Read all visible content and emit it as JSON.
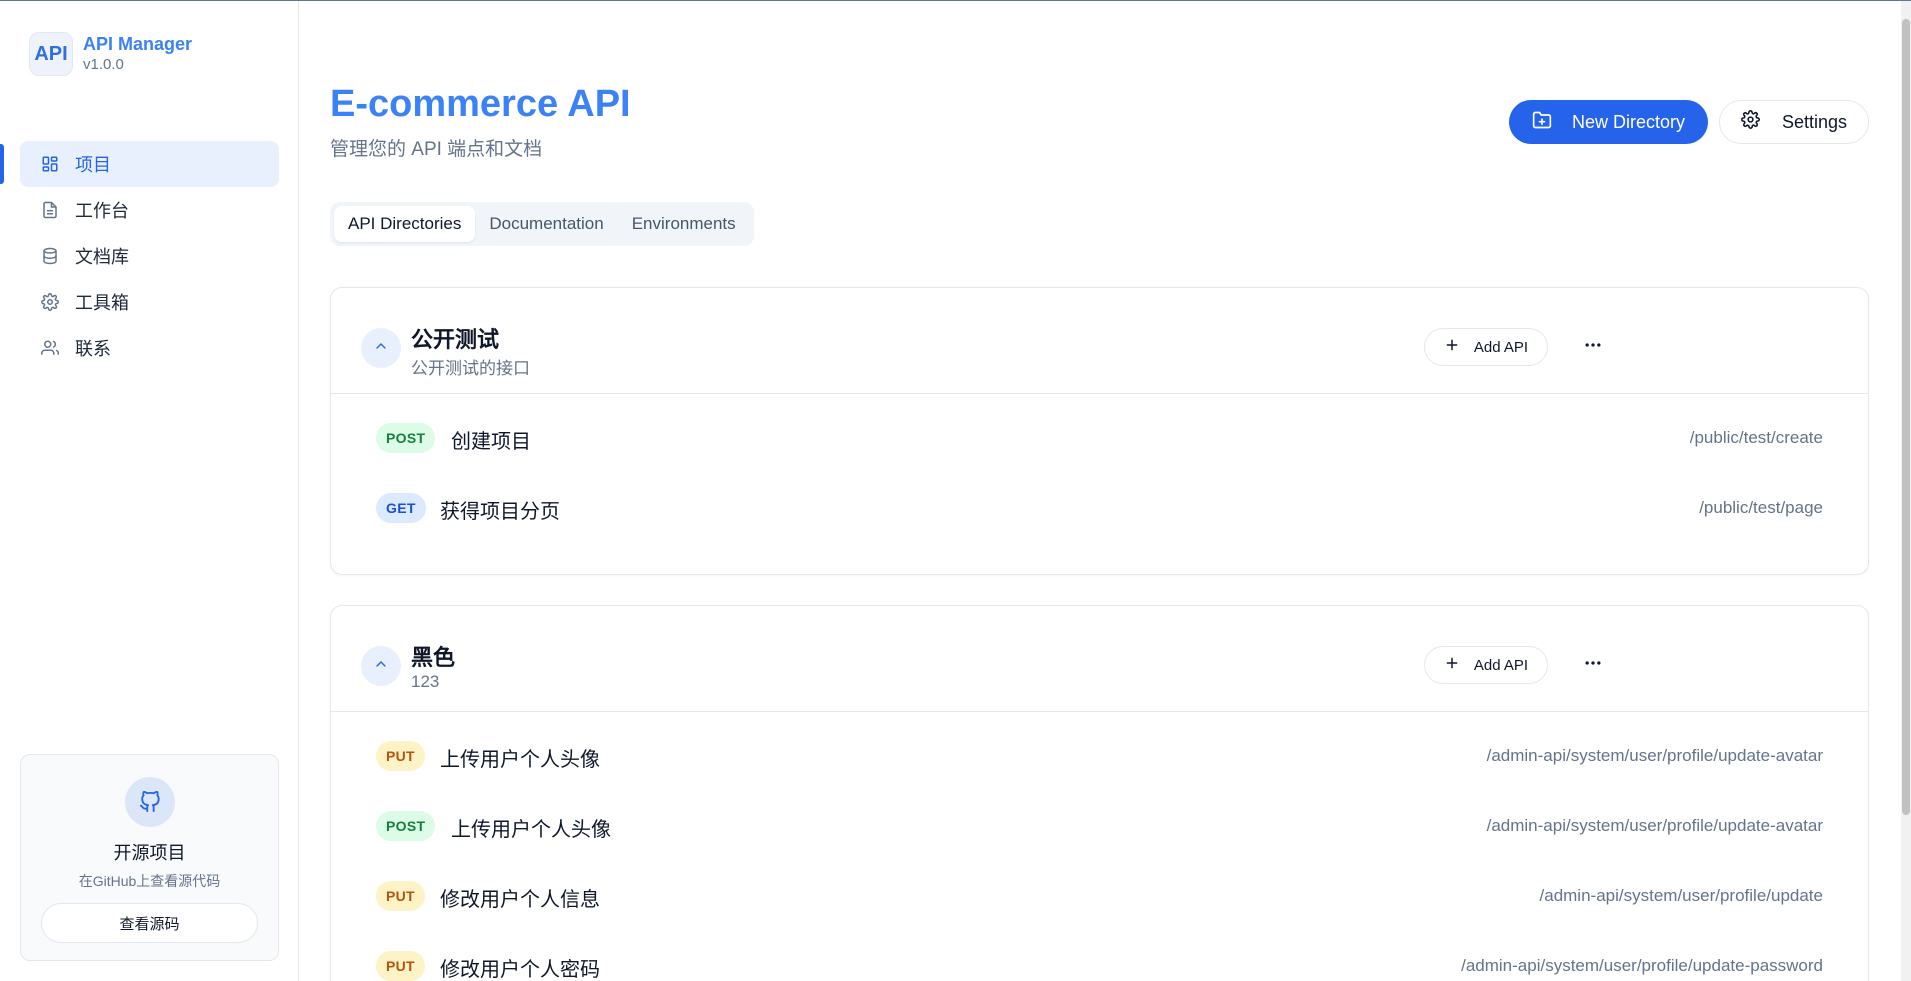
{
  "brand": {
    "logo": "API",
    "name": "API Manager",
    "version": "v1.0.0"
  },
  "sidebar": {
    "items": [
      {
        "label": "项目",
        "icon": "grid-icon",
        "active": true
      },
      {
        "label": "工作台",
        "icon": "file-icon",
        "active": false
      },
      {
        "label": "文档库",
        "icon": "database-icon",
        "active": false
      },
      {
        "label": "工具箱",
        "icon": "gear-icon",
        "active": false
      },
      {
        "label": "联系",
        "icon": "users-icon",
        "active": false
      }
    ],
    "oss": {
      "title": "开源项目",
      "subtitle": "在GitHub上查看源代码",
      "button": "查看源码",
      "icon": "github-icon"
    }
  },
  "header": {
    "title": "E-commerce API",
    "subtitle": "管理您的 API 端点和文档",
    "new_directory": "New Directory",
    "settings": "Settings"
  },
  "tabs": [
    {
      "label": "API Directories",
      "active": true
    },
    {
      "label": "Documentation",
      "active": false
    },
    {
      "label": "Environments",
      "active": false
    }
  ],
  "groups": [
    {
      "name": "公开测试",
      "description": "公开测试的接口",
      "add_label": "Add API",
      "endpoints": [
        {
          "method": "POST",
          "name": "创建项目",
          "path": "/public/test/create"
        },
        {
          "method": "GET",
          "name": "获得项目分页",
          "path": "/public/test/page"
        }
      ]
    },
    {
      "name": "黑色",
      "description": "123",
      "add_label": "Add API",
      "endpoints": [
        {
          "method": "PUT",
          "name": "上传用户个人头像",
          "path": "/admin-api/system/user/profile/update-avatar"
        },
        {
          "method": "POST",
          "name": "上传用户个人头像",
          "path": "/admin-api/system/user/profile/update-avatar"
        },
        {
          "method": "PUT",
          "name": "修改用户个人信息",
          "path": "/admin-api/system/user/profile/update"
        },
        {
          "method": "PUT",
          "name": "修改用户个人密码",
          "path": "/admin-api/system/user/profile/update-password"
        }
      ]
    }
  ],
  "colors": {
    "accent": "#2563eb",
    "title": "#3b82f6",
    "post": "#15803d",
    "get": "#1d4ed8",
    "put": "#b45309"
  }
}
